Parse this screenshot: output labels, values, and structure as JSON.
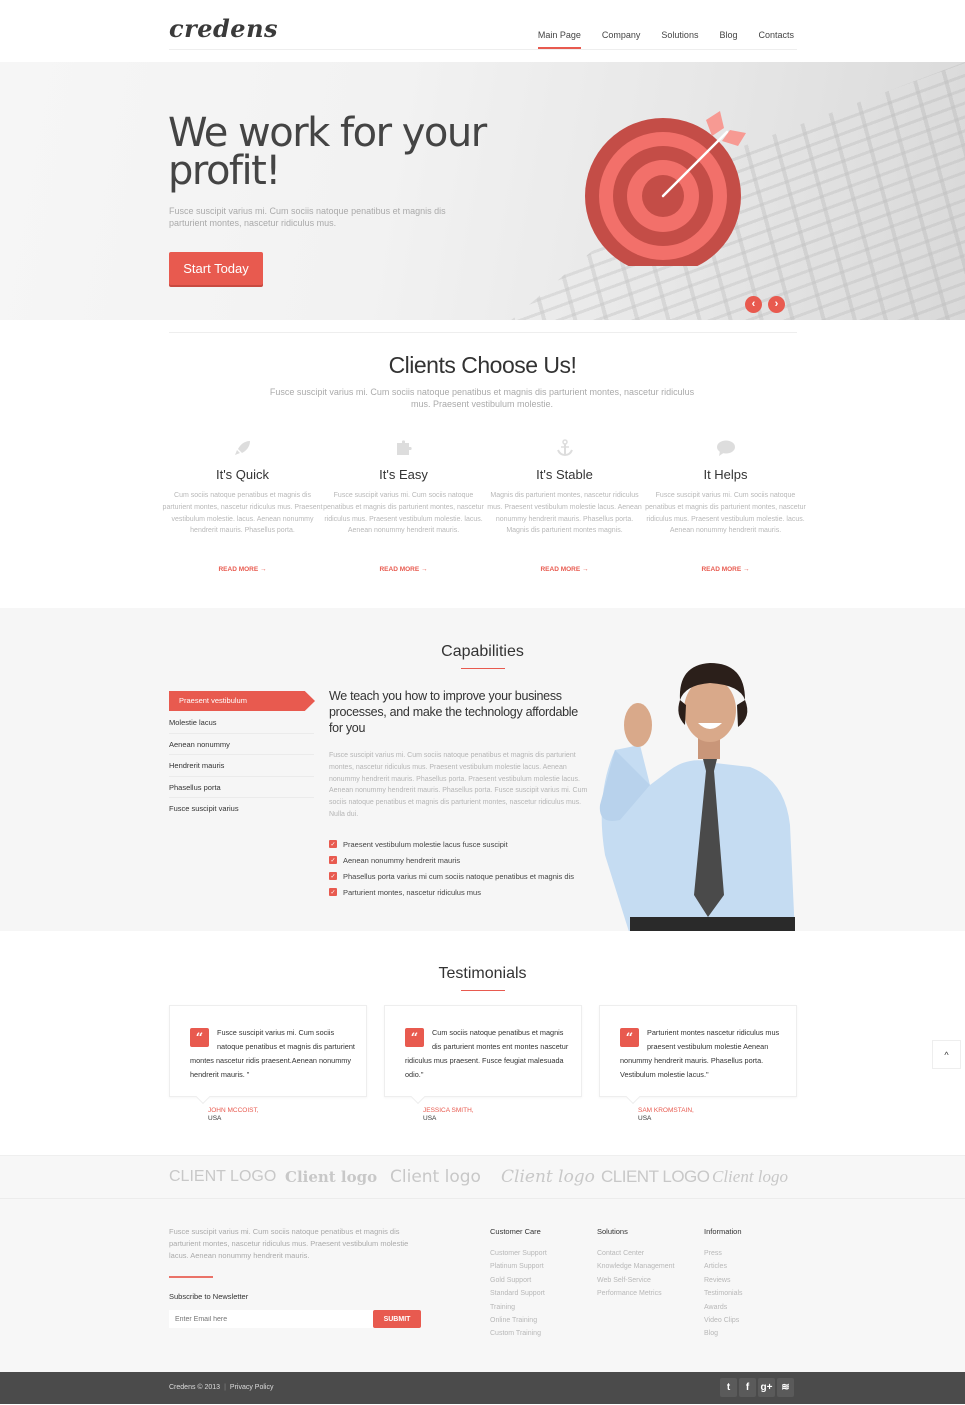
{
  "brand": {
    "logo": "credens",
    "accent": "#e85a4f"
  },
  "nav": {
    "items": [
      "Main Page",
      "Company",
      "Solutions",
      "Blog",
      "Contacts"
    ],
    "active": "Main Page"
  },
  "hero": {
    "title": "We work for your profit!",
    "text": "Fusce suscipit varius mi. Cum sociis natoque penatibus et magnis dis parturient montes, nascetur ridiculus mus.",
    "button": "Start Today",
    "prev_icon": "chevron-left-icon",
    "next_icon": "chevron-right-icon"
  },
  "clients": {
    "title": "Clients Choose Us!",
    "lead": "Fusce suscipit varius mi. Cum sociis natoque penatibus et magnis dis parturient montes, nascetur ridiculus mus. Praesent vestibulum molestie.",
    "features": [
      {
        "icon": "rocket-icon",
        "title": "It's Quick",
        "text": "Cum sociis natoque penatibus et magnis dis parturient montes, nascetur ridiculus mus. Praesent vestibulum molestie. lacus. Aenean nonummy hendrerit mauris. Phasellus porta.",
        "link": "READ MORE →"
      },
      {
        "icon": "puzzle-icon",
        "title": "It's Easy",
        "text": "Fusce suscipit varius mi. Cum sociis natoque penatibus et magnis dis parturient montes, nascetur ridiculus mus. Praesent vestibulum molestie. lacus. Aenean nonummy hendrerit mauris.",
        "link": "READ MORE →"
      },
      {
        "icon": "anchor-icon",
        "title": "It's Stable",
        "text": "Magnis dis parturient montes, nascetur ridiculus mus. Praesent vestibulum molestie lacus. Aenean nonummy hendrerit mauris. Phasellus porta. Magnis dis parturient montes magnis.",
        "link": "READ MORE →"
      },
      {
        "icon": "speech-bubble-icon",
        "title": "It Helps",
        "text": "Fusce suscipit varius mi. Cum sociis natoque penatibus et magnis dis parturient montes, nascetur ridiculus mus. Praesent vestibulum molestie. lacus. Aenean nonummy hendrerit mauris.",
        "link": "READ MORE →"
      }
    ]
  },
  "capabilities": {
    "title": "Capabilities",
    "menu": [
      "Praesent vestibulum",
      "Molestie lacus",
      "Aenean nonummy",
      "Hendrerit mauris",
      "Phasellus porta",
      "Fusce suscipit varius"
    ],
    "active": "Praesent vestibulum",
    "heading": "We teach you how to improve your business processes, and make the technology affordable for you",
    "body": "Fusce suscipit varius mi. Cum sociis natoque penatibus et magnis dis parturient montes, nascetur ridiculus mus. Praesent vestibulum molestie lacus. Aenean nonummy hendrerit mauris. Phasellus porta. Praesent vestibulum molestie lacus. Aenean nonummy hendrerit mauris. Phasellus porta. Fusce suscipit varius mi. Cum sociis natoque penatibus et magnis dis parturient montes, nascetur ridiculus mus. Nulla dui.",
    "checklist": [
      "Praesent vestibulum molestie lacus fusce suscipit",
      "Aenean nonummy hendrerit mauris",
      "Phasellus porta  varius mi cum sociis natoque penatibus et magnis dis",
      "Parturient montes, nascetur ridiculus mus"
    ]
  },
  "testimonials": {
    "title": "Testimonials",
    "items": [
      {
        "quote": "Fusce suscipit varius mi. Cum sociis natoque penatibus et magnis dis parturient montes nascetur ridis praesent.Aenean nonummy hendrerit mauris. \"",
        "name": "JOHN MCCOIST,",
        "country": "USA"
      },
      {
        "quote": "Cum sociis natoque penatibus et magnis dis parturient montes ent montes nascetur ridiculus mus praesent. Fusce feugiat malesuada odio.\"",
        "name": "JESSICA SMITH,",
        "country": "USA"
      },
      {
        "quote": "Parturient montes nascetur ridiculus mus praesent vestibulum molestie Aenean nonummy hendrerit mauris. Phasellus porta. Vestibulum molestie lacus.\"",
        "name": "SAM KROMSTAIN,",
        "country": "USA"
      }
    ],
    "to_top": "^"
  },
  "client_logos": [
    "CLIENT LOGO",
    "Client logo",
    "Client logo",
    "Client logo",
    "CLIENT LOGO",
    "Client logo"
  ],
  "footer": {
    "about": "Fusce suscipit varius mi. Cum sociis natoque penatibus et magnis dis parturient montes, nascetur ridiculus mus. Praesent vestibulum molestie lacus. Aenean nonummy hendrerit mauris.",
    "newsletter_label": "Subscribe to Newsletter",
    "email_placeholder": "Enter Email here",
    "submit": "SUBMIT",
    "columns": [
      {
        "title": "Customer Care",
        "links": [
          "Customer Support",
          "Platinum Support",
          "Gold Support",
          "Standard Support",
          "Training",
          "Online Training",
          "Custom Training"
        ]
      },
      {
        "title": "Solutions",
        "links": [
          "Contact Center",
          "Knowledge Management",
          "Web Self-Service",
          "Performance Metrics"
        ]
      },
      {
        "title": "Information",
        "links": [
          "Press",
          "Articles",
          "Reviews",
          "Testimonials",
          "Awards",
          "Video Clips",
          "Blog"
        ]
      }
    ],
    "copyright": "Credens © 2013",
    "privacy": "Privacy Policy",
    "socials": [
      "twitter-icon",
      "facebook-icon",
      "google-plus-icon",
      "rss-icon"
    ]
  }
}
